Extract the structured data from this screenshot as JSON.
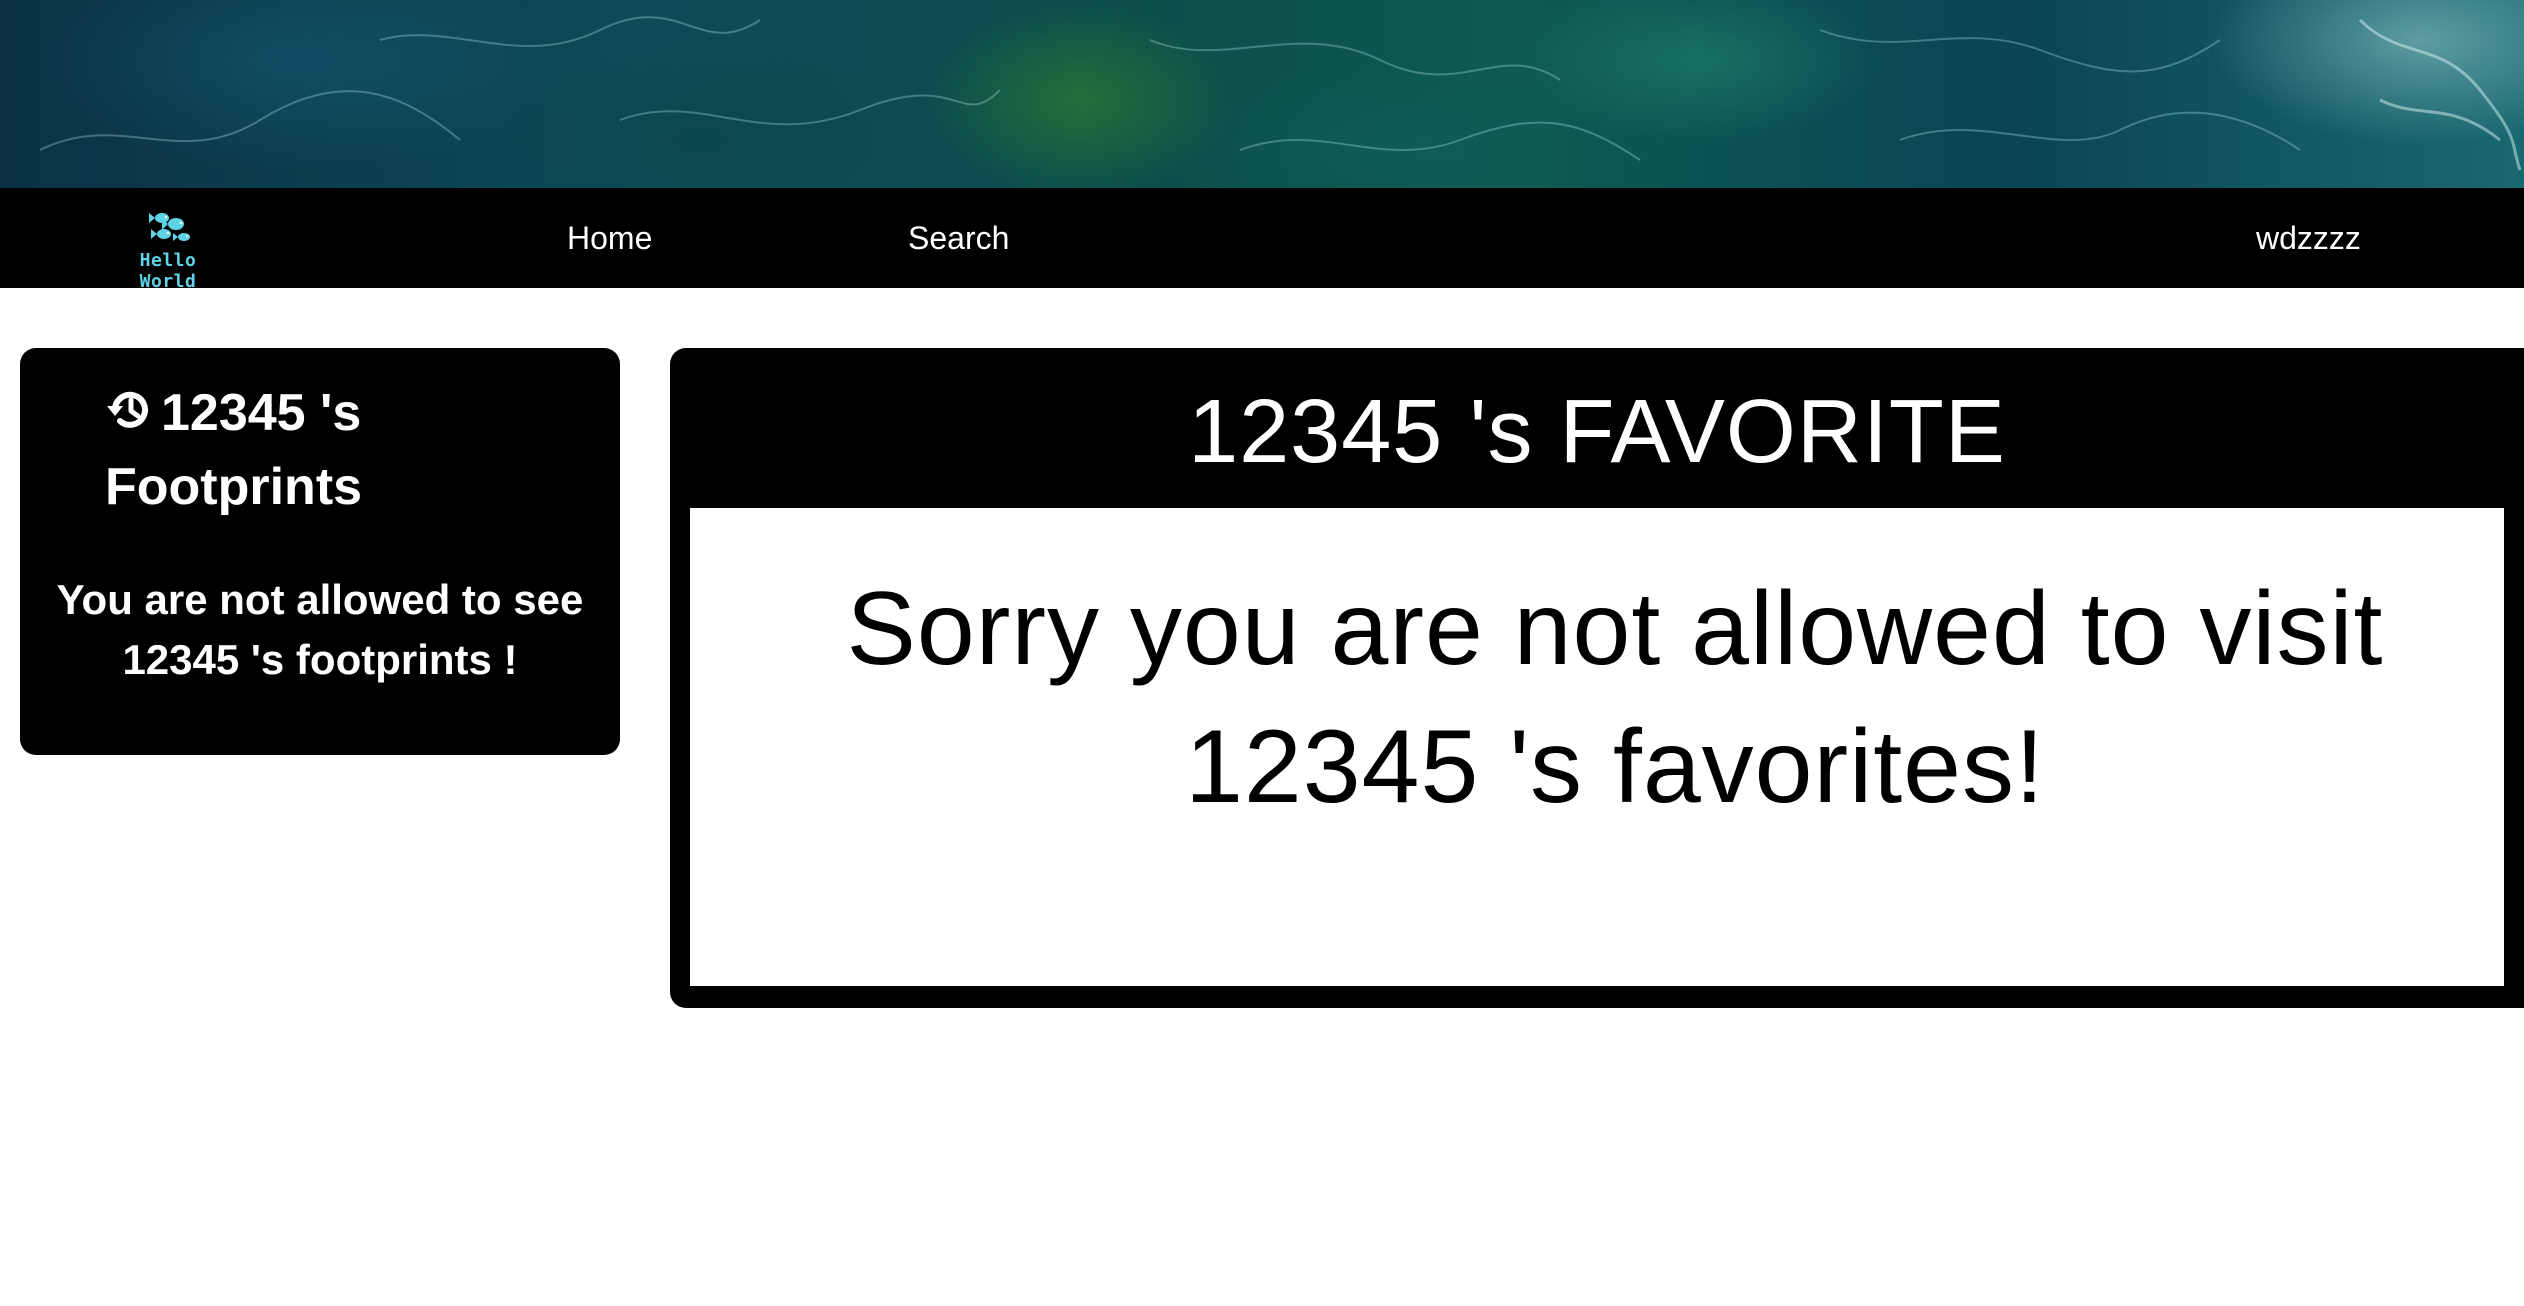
{
  "colors": {
    "page_background": "#ffffff",
    "nav_background": "#000000",
    "panel_background": "#000000",
    "logo_text": "#5fd3e6",
    "banner_theme": "#0d4a58"
  },
  "banner": {
    "image": "ocean-water-texture"
  },
  "nav": {
    "logo_text": "Hello World",
    "logo_icon": "fish-icon",
    "home_label": "Home",
    "search_label": "Search",
    "user_label": "wdzzzz"
  },
  "footprints": {
    "icon": "history-icon",
    "title": "12345 's Footprints",
    "message": "You are not allowed to see 12345 's footprints !"
  },
  "favorite": {
    "title": "12345 's FAVORITE",
    "message": "Sorry you are not allowed to visit 12345 's favorites!"
  }
}
